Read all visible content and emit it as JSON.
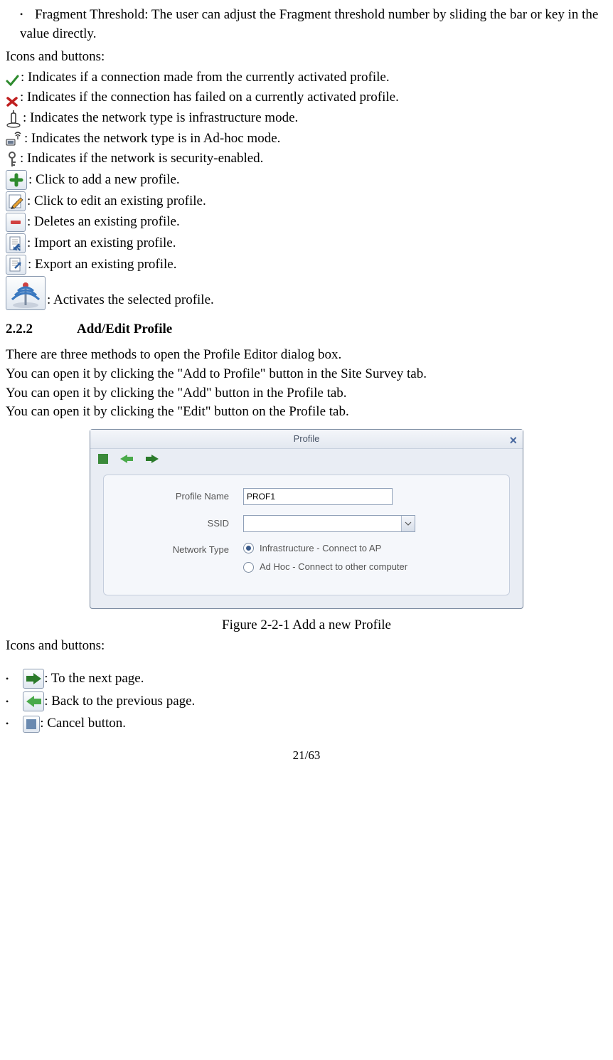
{
  "bullet_fragment": "Fragment Threshold: The user can adjust the Fragment threshold number by sliding the bar or key in the value directly.",
  "icons_buttons_label": "Icons and buttons:",
  "icon_desc": {
    "check": ": Indicates if a connection made from the currently activated profile.",
    "x": ": Indicates if the connection has failed on a currently activated profile.",
    "infra": ": Indicates the network type is infrastructure mode.",
    "adhoc": ": Indicates the network type is in Ad-hoc mode.",
    "key": ": Indicates if the network is security-enabled.",
    "add": ": Click to add a new profile.",
    "edit": ": Click to edit an existing profile.",
    "del": ": Deletes an existing profile.",
    "import": ": Import an existing profile.",
    "export": ": Export an existing profile.",
    "activate": ": Activates the selected profile."
  },
  "section": {
    "num": "2.2.2",
    "title": "Add/Edit Profile"
  },
  "para": [
    "There are three methods to open the Profile Editor dialog box.",
    "You can open it by clicking the \"Add to Profile\" button in the Site Survey tab.",
    "You can open it by clicking the \"Add\" button in the Profile tab.",
    "You can open it by clicking the \"Edit\" button on the Profile tab."
  ],
  "dialog": {
    "title": "Profile",
    "close": "×",
    "labels": {
      "profile_name": "Profile Name",
      "ssid": "SSID",
      "network_type": "Network Type"
    },
    "profile_name_value": "PROF1",
    "radio1": "Infrastructure - Connect to AP",
    "radio2": "Ad Hoc - Connect to other computer"
  },
  "figure_caption": "Figure 2-2-1 Add a new Profile",
  "icons_buttons_label2": "Icons and buttons:",
  "nav_desc": {
    "next": ": To the next page.",
    "back": ": Back to the previous page.",
    "cancel": ": Cancel button."
  },
  "page_num": "21/63"
}
